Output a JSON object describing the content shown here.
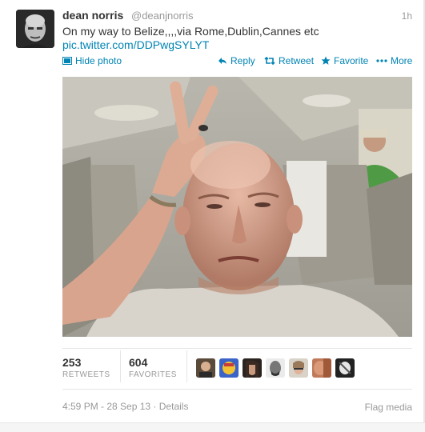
{
  "tweet": {
    "author_name": "dean norris",
    "handle": "@deanjnorris",
    "timestamp": "1h",
    "text": "On my way to Belize,,,,via Rome,Dublin,Cannes etc",
    "link": "pic.twitter.com/DDPwgSYLYT"
  },
  "actions": {
    "hide_photo": "Hide photo",
    "reply": "Reply",
    "retweet": "Retweet",
    "favorite": "Favorite",
    "more": "More"
  },
  "stats": {
    "retweets_count": "253",
    "retweets_label": "RETWEETS",
    "favorites_count": "604",
    "favorites_label": "FAVORITES"
  },
  "footer": {
    "datetime": "4:59 PM - 28 Sep 13",
    "separator": "·",
    "details": "Details",
    "flag_media": "Flag media"
  },
  "colors": {
    "link": "#0084b4",
    "muted": "#999999",
    "text": "#333333"
  },
  "favoriters_count": 7
}
